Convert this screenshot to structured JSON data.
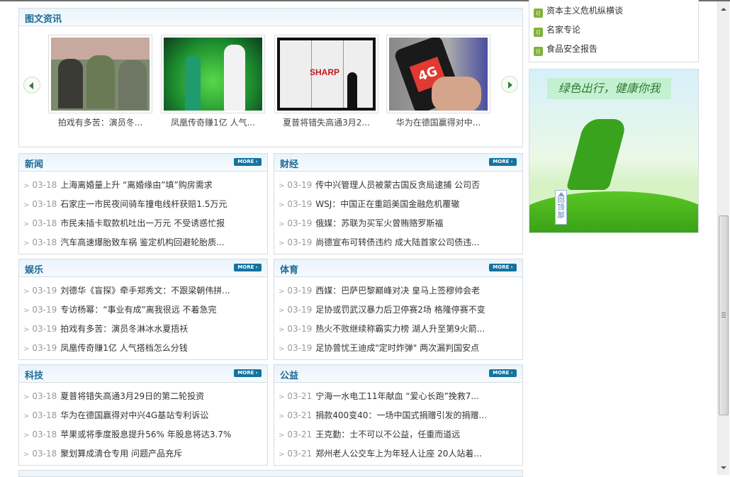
{
  "gallery": {
    "title": "图文资讯",
    "items": [
      {
        "caption": "拍戏有多苦：演员冬..."
      },
      {
        "caption": "凤凰传奇赚1亿 人气..."
      },
      {
        "caption": "夏普将错失高通3月2...",
        "logo_text": "SHARP"
      },
      {
        "caption": "华为在德国赢得对中...",
        "logo_text": "4G"
      }
    ]
  },
  "more_label": "MORE",
  "sections": [
    {
      "title": "新闻",
      "items": [
        {
          "date": "03-18",
          "text": "上海离婚量上升 “离婚缘由”填”购房需求"
        },
        {
          "date": "03-18",
          "text": "石家庄一市民夜间骑车撞电线杆获赔1.5万元"
        },
        {
          "date": "03-18",
          "text": "市民未插卡取款机吐出一万元 不受诱惑忙报"
        },
        {
          "date": "03-18",
          "text": "汽车高速爆胎致车祸 鉴定机构回避轮胎质..."
        }
      ]
    },
    {
      "title": "财经",
      "items": [
        {
          "date": "03-19",
          "text": "传中兴管理人员被蒙古国反贪局逮捕 公司否"
        },
        {
          "date": "03-19",
          "text": "WSJ：中国正在重蹈美国金融危机覆辙"
        },
        {
          "date": "03-19",
          "text": "俄媒：苏联为买军火曾贿赂罗斯福"
        },
        {
          "date": "03-19",
          "text": "尚德宣布可转债违约 成大陆首家公司债违..."
        }
      ]
    },
    {
      "title": "娱乐",
      "items": [
        {
          "date": "03-19",
          "text": "刘德华《盲探》牵手郑秀文：不跟梁朝伟拼..."
        },
        {
          "date": "03-19",
          "text": "专访杨幂：“事业有成”离我很远 不着急完"
        },
        {
          "date": "03-19",
          "text": "拍戏有多苦：演员冬淋冰水夏捂袄"
        },
        {
          "date": "03-19",
          "text": "凤凰传奇赚1亿 人气搭档怎么分钱"
        }
      ]
    },
    {
      "title": "体育",
      "items": [
        {
          "date": "03-19",
          "text": "西媒：巴萨巴黎巅峰对决 皇马上签穆帅会老"
        },
        {
          "date": "03-19",
          "text": "足协或罚武汉暴力后卫停赛2场 格隆停赛不变"
        },
        {
          "date": "03-19",
          "text": "热火不败继续称霸实力榜 湖人升至第9火箭..."
        },
        {
          "date": "03-19",
          "text": "足协曾忧王迪成\"定时炸弹\" 两次漏判国安点"
        }
      ]
    },
    {
      "title": "科技",
      "items": [
        {
          "date": "03-18",
          "text": "夏普将错失高通3月29日的第二轮投资"
        },
        {
          "date": "03-18",
          "text": "华为在德国赢得对中兴4G基站专利诉讼"
        },
        {
          "date": "03-18",
          "text": "苹果或将季度股息提升56% 年股息将达3.7%"
        },
        {
          "date": "03-18",
          "text": "聚划算成清仓专用 问题产品充斥"
        }
      ]
    },
    {
      "title": "公益",
      "items": [
        {
          "date": "03-21",
          "text": "宁海一水电工11年献血 “爱心长跑”挽救7..."
        },
        {
          "date": "03-21",
          "text": "捐款400变40：一场中国式捐赠引发的捐赠..."
        },
        {
          "date": "03-21",
          "text": "王克勤：士不可以不公益，任重而道远"
        },
        {
          "date": "03-21",
          "text": "郑州老人公交车上为年轻人让座 20人站着..."
        }
      ]
    }
  ],
  "sidebar": {
    "items": [
      {
        "label": "资本主义危机纵横谈"
      },
      {
        "label": "名家专论"
      },
      {
        "label": "食品安全报告"
      }
    ],
    "ad_slogan": "绿色出行，健康你我",
    "back_to_top": "回顶部"
  }
}
